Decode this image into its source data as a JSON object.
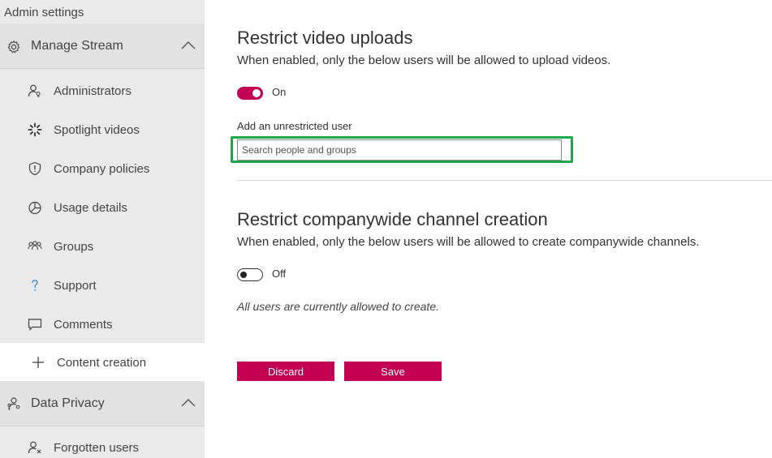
{
  "sidebar": {
    "title": "Admin settings",
    "sections": [
      {
        "label": "Manage Stream",
        "icon": "gear-icon",
        "expanded": true
      },
      {
        "label": "Data Privacy",
        "icon": "people-key-icon",
        "expanded": true
      }
    ],
    "items": [
      {
        "label": "Administrators",
        "icon": "person-key-icon"
      },
      {
        "label": "Spotlight videos",
        "icon": "spotlight-icon"
      },
      {
        "label": "Company policies",
        "icon": "shield-icon"
      },
      {
        "label": "Usage details",
        "icon": "pie-chart-icon"
      },
      {
        "label": "Groups",
        "icon": "groups-icon"
      },
      {
        "label": "Support",
        "icon": "question-icon"
      },
      {
        "label": "Comments",
        "icon": "comment-icon"
      },
      {
        "label": "Content creation",
        "icon": "plus-icon",
        "active": true
      }
    ],
    "privacy_items": [
      {
        "label": "Forgotten users",
        "icon": "person-remove-icon"
      }
    ]
  },
  "main": {
    "uploads": {
      "title": "Restrict video uploads",
      "description": "When enabled, only the below users will be allowed to upload videos.",
      "toggle_state": "on",
      "toggle_label": "On",
      "field_label": "Add an unrestricted user",
      "search_placeholder": "Search people and groups"
    },
    "channels": {
      "title": "Restrict companywide channel creation",
      "description": "When enabled, only the below users will be allowed to create companywide channels.",
      "toggle_state": "off",
      "toggle_label": "Off",
      "note": "All users are currently allowed to create."
    },
    "buttons": {
      "discard": "Discard",
      "save": "Save"
    }
  },
  "colors": {
    "accent": "#c30052",
    "highlight": "#1fa84a",
    "sidebar_bg": "#eaeaea"
  }
}
